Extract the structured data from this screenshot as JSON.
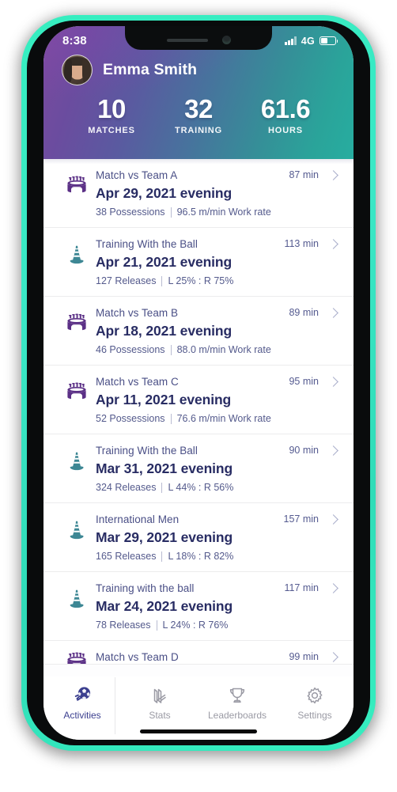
{
  "status_bar": {
    "time": "8:38",
    "network": "4G",
    "signal_icon": "signal-bars-icon",
    "battery_icon": "battery-icon"
  },
  "header": {
    "user_name": "Emma Smith",
    "avatar_icon": "user-avatar",
    "gradient_from": "#7b4a9e",
    "gradient_to": "#27ada0",
    "stats": [
      {
        "value": "10",
        "label": "MATCHES"
      },
      {
        "value": "32",
        "label": "TRAINING"
      },
      {
        "value": "61.6",
        "label": "HOURS"
      }
    ]
  },
  "activities": [
    {
      "icon": "stadium-icon",
      "type": "match",
      "title": "Match vs Team A",
      "duration": "87 min",
      "date": "Apr 29, 2021 evening",
      "stat_a": "38 Possessions",
      "stat_b": "96.5 m/min Work rate"
    },
    {
      "icon": "traffic-cone-icon",
      "type": "training",
      "title": "Training With the Ball",
      "duration": "113 min",
      "date": "Apr 21, 2021 evening",
      "stat_a": "127 Releases",
      "stat_b": "L 25%  : R 75%"
    },
    {
      "icon": "stadium-icon",
      "type": "match",
      "title": "Match vs Team B",
      "duration": "89 min",
      "date": "Apr 18, 2021 evening",
      "stat_a": "46 Possessions",
      "stat_b": "88.0 m/min Work rate"
    },
    {
      "icon": "stadium-icon",
      "type": "match",
      "title": "Match vs Team C",
      "duration": "95 min",
      "date": "Apr 11, 2021 evening",
      "stat_a": "52 Possessions",
      "stat_b": "76.6 m/min Work rate"
    },
    {
      "icon": "traffic-cone-icon",
      "type": "training",
      "title": "Training With the Ball",
      "duration": "90 min",
      "date": "Mar 31, 2021 evening",
      "stat_a": "324 Releases",
      "stat_b": "L 44%  : R 56%"
    },
    {
      "icon": "traffic-cone-icon",
      "type": "training",
      "title": "International Men",
      "duration": "157 min",
      "date": "Mar 29, 2021 evening",
      "stat_a": "165 Releases",
      "stat_b": "L 18%  : R 82%"
    },
    {
      "icon": "traffic-cone-icon",
      "type": "training",
      "title": "Training with the ball",
      "duration": "117 min",
      "date": "Mar 24, 2021 evening",
      "stat_a": "78 Releases",
      "stat_b": "L 24%  : R 76%"
    },
    {
      "icon": "stadium-icon",
      "type": "match",
      "title": "Match vs Team D",
      "duration": "99 min",
      "date": "",
      "stat_a": "",
      "stat_b": ""
    }
  ],
  "tabbar": {
    "items": [
      {
        "label": "Activities",
        "icon": "soccer-ball-icon",
        "active": true
      },
      {
        "label": "Stats",
        "icon": "bar-chart-icon",
        "active": false
      },
      {
        "label": "Leaderboards",
        "icon": "trophy-icon",
        "active": false
      },
      {
        "label": "Settings",
        "icon": "gear-icon",
        "active": false
      }
    ],
    "active_color": "#3b3f8f",
    "inactive_color": "#9a9aa4"
  },
  "theme": {
    "phone_glow": "#36efc0",
    "match_icon_color": "#5b3086",
    "training_icon_color": "#3d8794",
    "title_color": "#4a4f86",
    "date_color": "#282c63"
  }
}
